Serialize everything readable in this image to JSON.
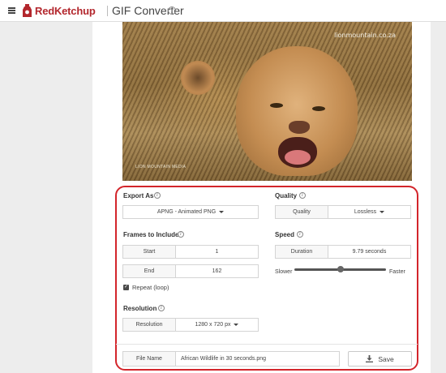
{
  "header": {
    "brand": "RedKetchup",
    "title": "GIF Converter"
  },
  "video": {
    "watermark": "lionmountain.co.za",
    "logo_text": "LION MOUNTAIN MEDIA"
  },
  "export": {
    "label": "Export As",
    "format": "APNG - Animated PNG"
  },
  "quality": {
    "label": "Quality",
    "key": "Quality",
    "value": "Lossless"
  },
  "frames": {
    "label": "Frames to Include",
    "start_key": "Start",
    "start_value": "1",
    "end_key": "End",
    "end_value": "162",
    "repeat_label": "Repeat (loop)",
    "repeat_checked": true
  },
  "speed": {
    "label": "Speed",
    "duration_key": "Duration",
    "duration_value": "9.79 seconds",
    "slower": "Slower",
    "faster": "Faster",
    "slider_position": 0.5
  },
  "resolution": {
    "label": "Resolution",
    "key": "Resolution",
    "value": "1280 x 720 px"
  },
  "file": {
    "key": "File Name",
    "value": "African Wildlife in 30 seconds.png"
  },
  "save": {
    "label": "Save",
    "icon": "download-icon"
  },
  "colors": {
    "brand": "#b3272d",
    "highlight_border": "#d3252b"
  }
}
